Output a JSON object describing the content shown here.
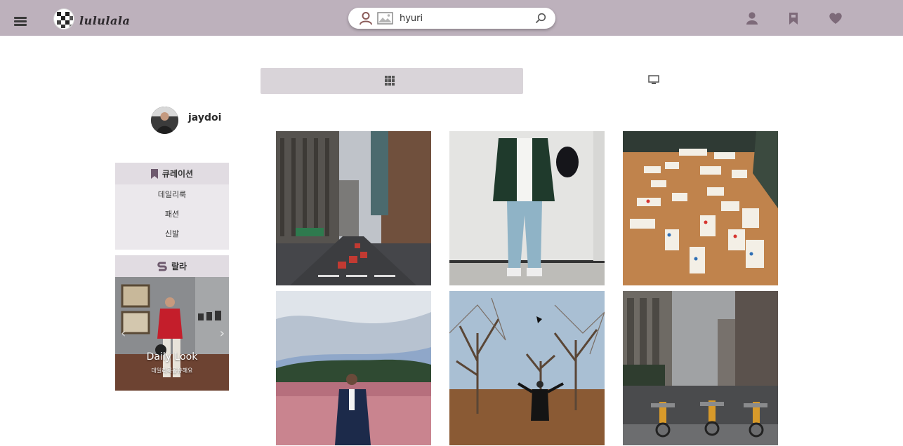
{
  "app": {
    "brand": "lululala"
  },
  "header": {
    "search_value": "hyuri",
    "icons": [
      "menu-icon",
      "person-icon",
      "image-icon",
      "search-icon",
      "user-icon",
      "bookmark-icon",
      "heart-icon"
    ]
  },
  "view_tabs": {
    "grid_icon": "grid-icon",
    "list_icon": "monitor-icon"
  },
  "profile": {
    "username": "jaydoi"
  },
  "curation": {
    "title": "큐레이션",
    "items": [
      {
        "label": "데일리룩"
      },
      {
        "label": "패션"
      },
      {
        "label": "신발"
      }
    ]
  },
  "lala": {
    "title": "랄라",
    "slide_title": "Daily Look",
    "slide_subtitle": "데일리룩공유해요"
  },
  "photos": [
    {
      "subject": "city-street"
    },
    {
      "subject": "outfit"
    },
    {
      "subject": "tile-game"
    },
    {
      "subject": "pink-field"
    },
    {
      "subject": "autumn-park"
    },
    {
      "subject": "bike-street"
    }
  ],
  "colors": {
    "header_bg": "#bdb1bc",
    "icon_color": "#7d6a79",
    "tab_active_bg": "#d9d4d9",
    "panel_bg": "#ebe8ec",
    "accent": "#6e5a6e"
  }
}
